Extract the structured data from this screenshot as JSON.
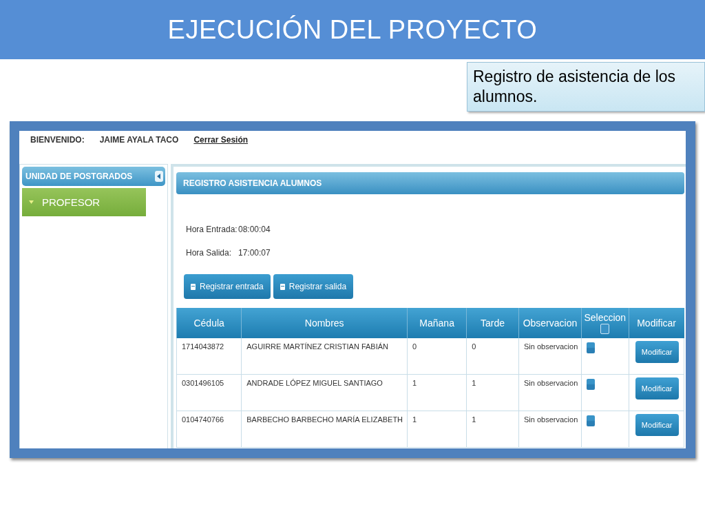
{
  "slide": {
    "title": "EJECUCIÓN DEL PROYECTO",
    "callout": "Registro de asistencia de los alumnos."
  },
  "app": {
    "welcome_label": "BIENVENIDO:",
    "user_name": "JAIME AYALA TACO",
    "logout_link": "Cerrar Sesión",
    "sidebar": {
      "title": "UNIDAD DE POSTGRADOS",
      "items": [
        {
          "label": "PROFESOR",
          "selected": true
        }
      ]
    },
    "panel": {
      "title": "REGISTRO ASISTENCIA ALUMNOS",
      "fields": [
        {
          "label": "Hora Entrada:",
          "value": "08:00:04"
        },
        {
          "label": "Hora Salida:",
          "value": "17:00:07"
        }
      ],
      "buttons": [
        "Registrar entrada",
        "Registrar salida"
      ]
    },
    "table": {
      "columns": [
        "Cédula",
        "Nombres",
        "Mañana",
        "Tarde",
        "Observacion",
        "Seleccion",
        "Modificar"
      ],
      "select_all_checked": false,
      "rows": [
        {
          "cedula": "1714043872",
          "nombres": "AGUIRRE MARTÍNEZ CRISTIAN FABIÁN",
          "manana": "0",
          "tarde": "0",
          "observacion": "Sin observacion",
          "checked": false,
          "action": "Modificar"
        },
        {
          "cedula": "0301496105",
          "nombres": "ANDRADE LÓPEZ MIGUEL SANTIAGO",
          "manana": "1",
          "tarde": "1",
          "observacion": "Sin observacion",
          "checked": false,
          "action": "Modificar"
        },
        {
          "cedula": "0104740766",
          "nombres": "BARBECHO BARBECHO MARÍA ELIZABETH",
          "manana": "1",
          "tarde": "1",
          "observacion": "Sin observacion",
          "checked": false,
          "action": "Modificar"
        }
      ]
    }
  }
}
